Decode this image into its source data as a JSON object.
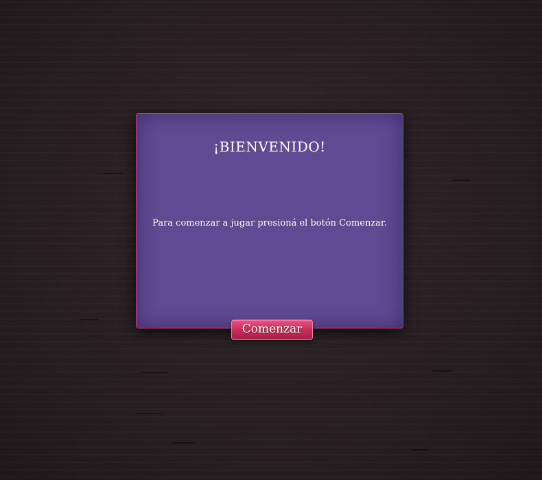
{
  "dialog": {
    "title": "¡BIENVENIDO!",
    "message": "Para comenzar a jugar presioná el botón Comenzar."
  },
  "start_button": {
    "label": "Comenzar"
  },
  "colors": {
    "background": "#2a2326",
    "dialog": "#5f4a93",
    "dialog_border": "#b0407a",
    "button": "#c72e5b",
    "text": "#ffffff"
  }
}
